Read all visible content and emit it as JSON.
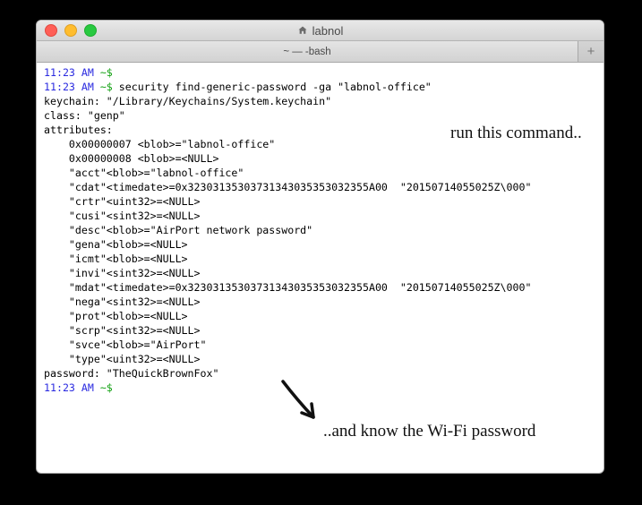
{
  "window": {
    "title": "labnol",
    "tab_label": "~ — -bash",
    "plus_label": "+"
  },
  "prompt": {
    "timestamp": "11:23 AM",
    "path": "~$"
  },
  "command": "security find-generic-password -ga \"labnol-office\"",
  "output": {
    "keychain": "keychain: \"/Library/Keychains/System.keychain\"",
    "class": "class: \"genp\"",
    "attr_header": "attributes:",
    "attrs": [
      "    0x00000007 <blob>=\"labnol-office\"",
      "    0x00000008 <blob>=<NULL>",
      "    \"acct\"<blob>=\"labnol-office\"",
      "    \"cdat\"<timedate>=0x32303135303731343035353032355A00  \"20150714055025Z\\000\"",
      "    \"crtr\"<uint32>=<NULL>",
      "    \"cusi\"<sint32>=<NULL>",
      "    \"desc\"<blob>=\"AirPort network password\"",
      "    \"gena\"<blob>=<NULL>",
      "    \"icmt\"<blob>=<NULL>",
      "    \"invi\"<sint32>=<NULL>",
      "    \"mdat\"<timedate>=0x32303135303731343035353032355A00  \"20150714055025Z\\000\"",
      "    \"nega\"<sint32>=<NULL>",
      "    \"prot\"<blob>=<NULL>",
      "    \"scrp\"<sint32>=<NULL>",
      "    \"svce\"<blob>=\"AirPort\"",
      "    \"type\"<uint32>=<NULL>"
    ],
    "password": "password: \"TheQuickBrownFox\""
  },
  "annotations": {
    "a1": "run this command..",
    "a2": "..and know the Wi-Fi password"
  }
}
